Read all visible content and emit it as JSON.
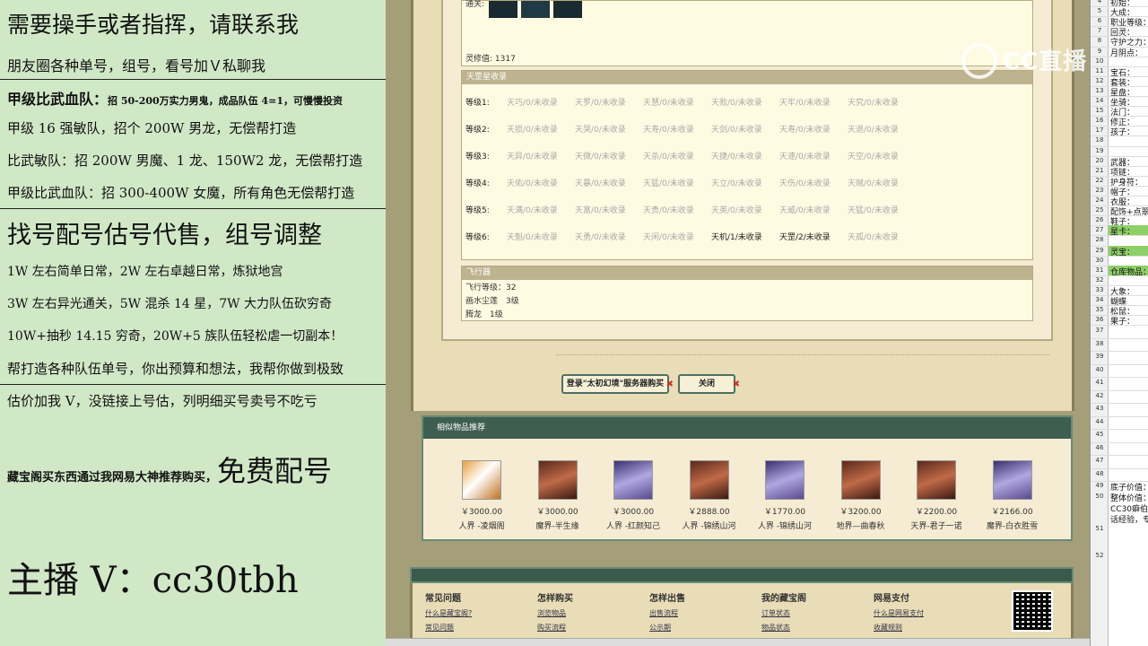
{
  "promo": {
    "line1": "需要操手或者指挥，请联系我",
    "line2": "朋友圈各种单号，组号，看号加Ｖ私聊我",
    "line3_a": "甲级比武血队：",
    "line3_b": "招 50-200万实力男鬼，成品队伍 4=1，可慢慢投资",
    "line4": "甲级 16 强敏队，招个 200W 男龙，无偿帮打造",
    "line5": "比武敏队：招 200W 男魔、1 龙、150W2 龙，无偿帮打造",
    "line6": "甲级比武血队：招 300-400W 女魔，所有角色无偿帮打造",
    "line7": "找号配号估号代售，组号调整",
    "line8": "1W 左右简单日常，2W 左右卓越日常，炼狱地宫",
    "line9": "3W 左右异光通关，5W 混杀 14 星，7W 大力队伍砍穷奇",
    "line10": "10W+抽秒 14.15 穷奇，20W+5 族队伍轻松虐一切副本！",
    "line11": "帮打造各种队伍单号，你出预算和想法，我帮你做到极致",
    "line12": "估价加我 V，没链接上号估，列明细买号卖号不吃亏",
    "line13_a": "藏宝阁买东西通过我网易大神推荐购买，",
    "line13_b": "免费配号",
    "line14": "主播 V：cc30tbh"
  },
  "top_panel": {
    "pass_label": "通关:",
    "lingxiu_label": "灵修值:",
    "lingxiu_value": "1317"
  },
  "star_panel": {
    "title": "天罡星收录",
    "rows": [
      {
        "label": "等级1:",
        "cells": [
          "天巧/0/未收录",
          "天罗/0/未收录",
          "天慧/0/未收录",
          "天败/0/未收录",
          "天牢/0/未收录",
          "天究/0/未收录"
        ]
      },
      {
        "label": "等级2:",
        "cells": [
          "天损/0/未收录",
          "天哭/0/未收录",
          "天寿/0/未收录",
          "天剑/0/未收录",
          "天寿/0/未收录",
          "天退/0/未收录"
        ]
      },
      {
        "label": "等级3:",
        "cells": [
          "天异/0/未收录",
          "天微/0/未收录",
          "天杀/0/未收录",
          "天捷/0/未收录",
          "天速/0/未收录",
          "天空/0/未收录"
        ]
      },
      {
        "label": "等级4:",
        "cells": [
          "天佑/0/未收录",
          "天暴/0/未收录",
          "天猛/0/未收录",
          "天立/0/未收录",
          "天伤/0/未收录",
          "天贼/0/未收录"
        ]
      },
      {
        "label": "等级5:",
        "cells": [
          "天满/0/未收录",
          "天富/0/未收录",
          "天贵/0/未收录",
          "天英/0/未收录",
          "天威/0/未收录",
          "天猛/0/未收录"
        ]
      },
      {
        "label": "等级6:",
        "cells": [
          "天魁/0/未收录",
          "天勇/0/未收录",
          "天闲/0/未收录",
          "天机/1/未收录",
          "天罡/2/未收录",
          "天孤/0/未收录"
        ]
      }
    ]
  },
  "fly_panel": {
    "title": "飞行器",
    "line1": "飞行等级：32",
    "line2": "画水尘莲　3级",
    "line3": "腾龙　1级"
  },
  "buttons": {
    "login": "登录\"太初幻境\"服务器购买",
    "close": "关闭"
  },
  "similar": {
    "title": "相似物品推荐",
    "items": [
      {
        "price": "￥3000.00",
        "name": "人界 -凌烟阁",
        "avatar": "tiger"
      },
      {
        "price": "￥3000.00",
        "name": "魔界-半生缘",
        "avatar": "red"
      },
      {
        "price": "￥3000.00",
        "name": "人界 -红颜知己",
        "avatar": "purple"
      },
      {
        "price": "￥2888.00",
        "name": "人界 -锦绣山河",
        "avatar": "red"
      },
      {
        "price": "￥1770.00",
        "name": "人界 -锦绣山河",
        "avatar": "purple"
      },
      {
        "price": "￥3200.00",
        "name": "地界—曲春秋",
        "avatar": "red"
      },
      {
        "price": "￥2200.00",
        "name": "天界-君子一诺",
        "avatar": "red"
      },
      {
        "price": "￥2166.00",
        "name": "魔界-白衣胜雪",
        "avatar": "purple"
      }
    ]
  },
  "footer": {
    "cols": [
      {
        "title": "常见问题",
        "links": [
          "什么是藏宝阁?",
          "常见问题"
        ]
      },
      {
        "title": "怎样购买",
        "links": [
          "浏览物品",
          "购买流程"
        ]
      },
      {
        "title": "怎样出售",
        "links": [
          "出售流程",
          "公示期"
        ]
      },
      {
        "title": "我的藏宝阁",
        "links": [
          "订单状态",
          "物品状态"
        ]
      },
      {
        "title": "网易支付",
        "links": [
          "什么是网易支付",
          "收藏规则"
        ]
      }
    ]
  },
  "watermark": "CC直播",
  "sheet": {
    "rows": [
      {
        "n": "4",
        "text": "初始："
      },
      {
        "n": "5",
        "text": "大成："
      },
      {
        "n": "6",
        "text": "职业等级："
      },
      {
        "n": "7",
        "text": "回灵："
      },
      {
        "n": "8",
        "text": "守护之力："
      },
      {
        "n": "9",
        "text": "月阴点："
      },
      {
        "n": "10",
        "text": ""
      },
      {
        "n": "11",
        "text": "宝石："
      },
      {
        "n": "12",
        "text": "套装："
      },
      {
        "n": "13",
        "text": "星盘："
      },
      {
        "n": "14",
        "text": "坐骑："
      },
      {
        "n": "15",
        "text": "法门："
      },
      {
        "n": "16",
        "text": "修正："
      },
      {
        "n": "17",
        "text": "孩子："
      },
      {
        "n": "18",
        "text": ""
      },
      {
        "n": "19",
        "text": ""
      },
      {
        "n": "20",
        "text": "武器："
      },
      {
        "n": "21",
        "text": "项链："
      },
      {
        "n": "22",
        "text": "护身符："
      },
      {
        "n": "23",
        "text": "帽子："
      },
      {
        "n": "24",
        "text": "衣服："
      },
      {
        "n": "25",
        "text": "配饰+点翠"
      },
      {
        "n": "26",
        "text": "鞋子："
      },
      {
        "n": "27",
        "text": "星卡："
      },
      {
        "n": "28",
        "text": ""
      },
      {
        "n": "29",
        "text": "灵宝："
      },
      {
        "n": "30",
        "text": ""
      },
      {
        "n": "31",
        "text": "仓库物品："
      },
      {
        "n": "32",
        "text": ""
      },
      {
        "n": "33",
        "text": "大象："
      },
      {
        "n": "34",
        "text": "蝴蝶"
      },
      {
        "n": "35",
        "text": "松鼠："
      },
      {
        "n": "36",
        "text": "果子："
      }
    ],
    "lower_rows": [
      "37",
      "38",
      "39",
      "40",
      "41",
      "42",
      "43",
      "44",
      "45",
      "46",
      "47",
      "48"
    ],
    "bottom": [
      {
        "n": "49",
        "text": "底子价值："
      },
      {
        "n": "50",
        "text": "整体价值："
      },
      {
        "n": "",
        "text": "CC30癖伯由"
      },
      {
        "n": "",
        "text": "话经验，专"
      },
      {
        "n": "51",
        "text": ""
      },
      {
        "n": "52",
        "text": ""
      }
    ]
  }
}
